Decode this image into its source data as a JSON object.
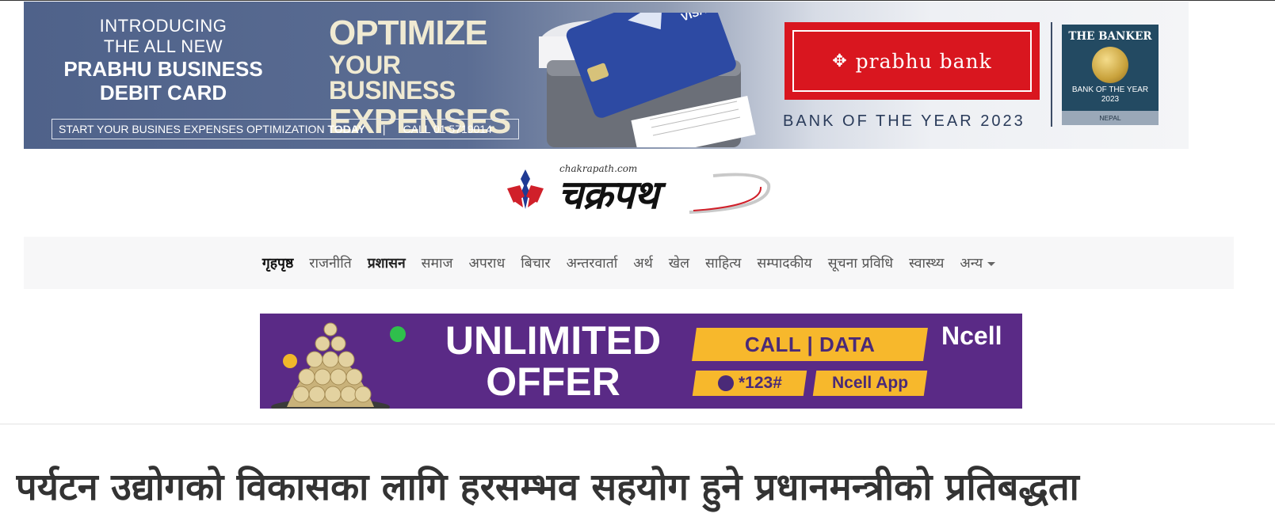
{
  "banner_top": {
    "intro_line1": "INTRODUCING",
    "intro_line2": "THE ALL NEW",
    "intro_line3": "PRABHU BUSINESS",
    "intro_line4": "DEBIT CARD",
    "headline1": "OPTIMIZE",
    "headline2": "YOUR BUSINESS",
    "headline3": "EXPENSES",
    "strip_text": "START YOUR BUSINES EXPENSES OPTIMIZATION",
    "strip_bold": "TODAY",
    "strip_sep": "|",
    "strip_call": "CALL 01 5719014",
    "bank_name": "prabhu bank",
    "award_text": "BANK OF THE YEAR 2023",
    "banker_title": "THE BANKER",
    "banker_sub1": "BANK OF THE YEAR",
    "banker_sub2": "2023",
    "banker_country": "NEPAL",
    "card_brand": "VISA",
    "brand_red": "#d9161f",
    "bg_blue": "#4f628a"
  },
  "logo": {
    "small": "chakrapath.com",
    "text": "चक्रपथ"
  },
  "nav": {
    "items": [
      {
        "label": "गृहपृष्ठ",
        "state": "active"
      },
      {
        "label": "राजनीति",
        "state": "normal"
      },
      {
        "label": "प्रशासन",
        "state": "bold"
      },
      {
        "label": "समाज",
        "state": "normal"
      },
      {
        "label": "अपराध",
        "state": "normal"
      },
      {
        "label": "बिचार",
        "state": "normal"
      },
      {
        "label": "अन्तरवार्ता",
        "state": "normal"
      },
      {
        "label": "अर्थ",
        "state": "normal"
      },
      {
        "label": "खेल",
        "state": "normal"
      },
      {
        "label": "साहित्य",
        "state": "normal"
      },
      {
        "label": "सम्पादकीय",
        "state": "normal"
      },
      {
        "label": "सूचना प्रविधि",
        "state": "normal"
      },
      {
        "label": "स्वास्थ्य",
        "state": "normal"
      },
      {
        "label": "अन्य",
        "state": "dropdown"
      }
    ]
  },
  "banner_mid": {
    "title_line1": "UNLIMITED",
    "title_line2": "OFFER",
    "pill_main": "CALL | DATA",
    "pill_code": "*123#",
    "pill_app": "Ncell App",
    "brand": "Ncell",
    "bg_purple": "#5a2a86",
    "accent_yellow": "#f7b82c"
  },
  "article": {
    "headline": "पर्यटन उद्योगको विकासका लागि हरसम्भव सहयोग हुने प्रधानमन्त्रीको प्रतिबद्धता"
  }
}
